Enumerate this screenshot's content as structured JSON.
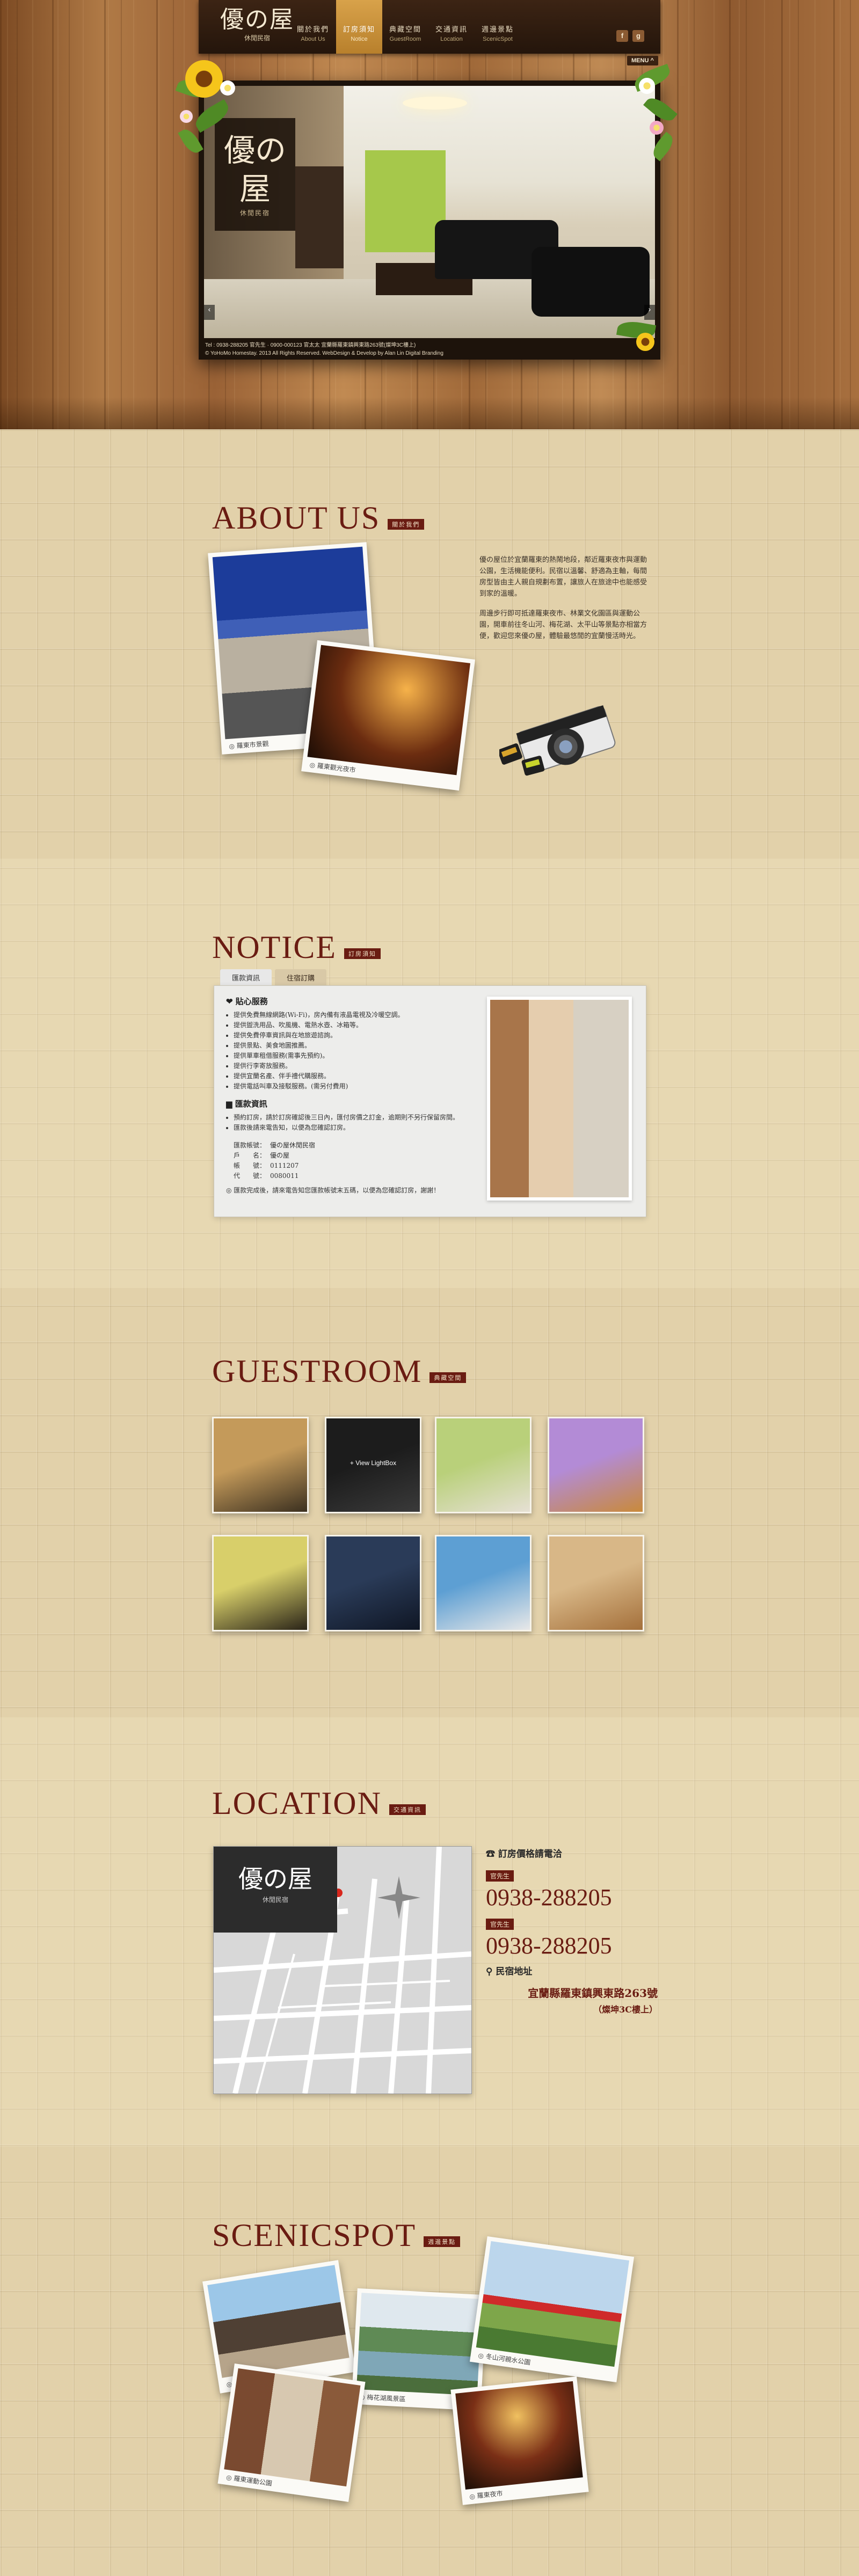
{
  "brand": {
    "logo_main": "優の屋",
    "logo_sub": "休閒民宿"
  },
  "nav": [
    {
      "zh": "關於我們",
      "en": "About Us"
    },
    {
      "zh": "訂房須知",
      "en": "Notice"
    },
    {
      "zh": "典藏空間",
      "en": "GuestRoom"
    },
    {
      "zh": "交通資訊",
      "en": "Location"
    },
    {
      "zh": "週邊景點",
      "en": "ScenicSpot"
    }
  ],
  "social": [
    "f",
    "g"
  ],
  "menu_toggle": "MENU ^",
  "hero": {
    "stamp_main": "優の屋",
    "stamp_sub": "休閒民宿",
    "footer_line1": "Tel : 0938-288205 官先生 · 0900-000123 官太太    宜蘭縣羅東鎮興東路263號(燦坤3C樓上)",
    "footer_line2": "© YoHoMo Homestay. 2013 All Rights Reserved. WebDesign & Develop by Alan Lin Digital Branding",
    "prev": "‹",
    "next": "›"
  },
  "about": {
    "title": "ABOUT US",
    "tag": "關於我們",
    "photo1_caption": "◎ 羅東市景觀",
    "photo2_caption": "◎ 羅東觀光夜市",
    "paragraphs": [
      "優の屋位於宜蘭羅東的熱鬧地段，鄰近羅東夜市與運動公園，生活機能便利。民宿以溫馨、舒適為主軸，每間房型皆由主人親自規劃布置，讓旅人在旅途中也能感受到家的溫暖。",
      "周邊步行即可抵達羅東夜市、林業文化園區與運動公園，開車前往冬山河、梅花湖、太平山等景點亦相當方便，歡迎您來優の屋，體驗最悠閒的宜蘭慢活時光。"
    ]
  },
  "notice": {
    "title": "NOTICE",
    "tag": "訂房須知",
    "tabs": [
      "匯款資訊",
      "住宿訂購"
    ],
    "service_heading": "貼心服務",
    "services": [
      "提供免費無線網路(Wi-Fi)，房內備有液晶電視及冷暖空調。",
      "提供盥洗用品、吹風機、電熱水壺、冰箱等。",
      "提供免費停車資訊與在地旅遊諮詢。",
      "提供景點、美食地圖推薦。",
      "提供單車租借服務(需事先預約)。",
      "提供行李寄放服務。",
      "提供宜蘭名產、伴手禮代購服務。",
      "提供電話叫車及接駁服務。(需另付費用)"
    ],
    "bank_heading": "匯款資訊",
    "bank_intro": [
      "預約訂房，請於訂房確認後三日內，匯付房價之訂金，逾期則不另行保留房間。",
      "匯款後請來電告知，以便為您確認訂房。"
    ],
    "bank_rows": [
      {
        "k": "匯款帳號：",
        "v": "優の屋休閒民宿"
      },
      {
        "k": "戶　　名：",
        "v": "優の屋"
      },
      {
        "k": "帳　　號：",
        "v": "0111207"
      },
      {
        "k": "代　　號：",
        "v": "0080011"
      }
    ],
    "bank_note": "◎ 匯款完成後，請來電告知您匯款帳號末五碼，以便為您確認訂房，謝謝！"
  },
  "guestroom": {
    "title": "GUESTROOM",
    "tag": "典藏空間",
    "lightbox_label": "+ View LightBox",
    "thumb_colors": [
      [
        "#c49a5a",
        "#3b3020"
      ],
      [
        "#1c1c1c",
        "#3a3a3a"
      ],
      [
        "#b9d07a",
        "#e6e0d4"
      ],
      [
        "#b38bd6",
        "#c98a3a"
      ],
      [
        "#d8cf6a",
        "#2a2418"
      ],
      [
        "#2a3b58",
        "#0f1624"
      ],
      [
        "#5d9fd3",
        "#e8e8e8"
      ],
      [
        "#d8b787",
        "#a4703b"
      ]
    ]
  },
  "location": {
    "title": "LOCATION",
    "tag": "交通資訊",
    "map_logo": "優の屋",
    "map_sub": "休閒民宿",
    "phone_heading": "訂房價格請電洽",
    "contacts": [
      {
        "who": "官先生",
        "num": "0938-288205"
      },
      {
        "who": "官先生",
        "num": "0938-288205"
      }
    ],
    "addr_heading": "民宿地址",
    "address": "宜蘭縣羅東鎮興東路263號",
    "address_note": "（燦坤3C樓上）"
  },
  "scenic": {
    "title": "SCENICSPOT",
    "tag": "週邊景點",
    "captions": [
      "◎ 羅東林場",
      "◎ 梅花湖風景區",
      "◎ 冬山河親水公園",
      "◎ 羅東運動公園",
      "◎ 羅東夜市"
    ]
  }
}
